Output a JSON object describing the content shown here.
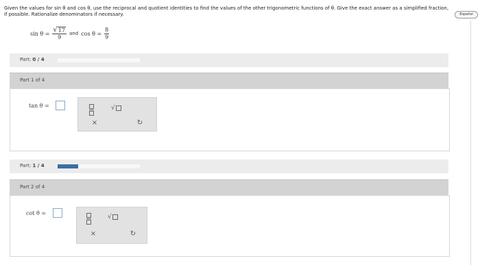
{
  "question": {
    "text": "Given the values for sin θ and cos θ, use the reciprocal and quotient identities to find the values of the other trigonometric functions of θ. Give the exact answer as a simplified fraction, if possible. Rationalize denominators if necessary."
  },
  "language_button": "Español",
  "given": {
    "sin_lhs": "sin θ =",
    "sin_num": "17",
    "sin_den": "9",
    "and": "and",
    "cos_lhs": "cos θ =",
    "cos_num": "8",
    "cos_den": "9"
  },
  "parts": [
    {
      "progress_label": "Part:",
      "progress_value": "0 / 4",
      "progress_fraction": 0.0,
      "header": "Part 1 of 4",
      "expression": "tan θ =",
      "clear_symbol": "×",
      "undo_symbol": "↻"
    },
    {
      "progress_label": "Part:",
      "progress_value": "1 / 4",
      "progress_fraction": 0.25,
      "header": "Part 2 of 4",
      "expression": "cot θ =",
      "clear_symbol": "×",
      "undo_symbol": "↻"
    }
  ],
  "colors": {
    "progress_fill": "#3a6ea5",
    "header_bg": "#d3d3d3",
    "panel_bg": "#e2e2e2"
  }
}
